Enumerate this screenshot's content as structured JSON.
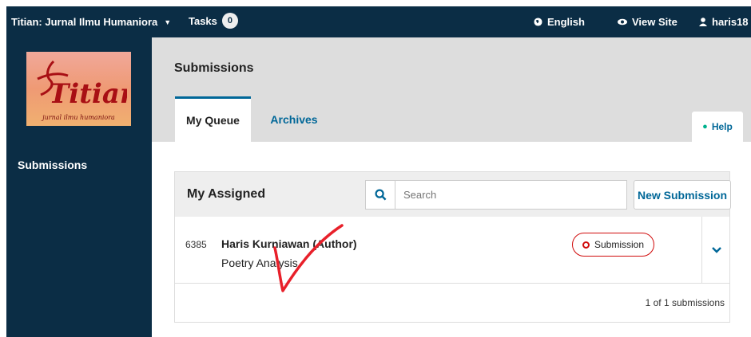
{
  "topbar": {
    "context": "Titian: Jurnal Ilmu Humaniora",
    "tasks_label": "Tasks",
    "tasks_count": "0",
    "language": "English",
    "view_site": "View Site",
    "user": "haris18"
  },
  "sidebar": {
    "logo": {
      "wordmark": "Titian",
      "tagline": "jurnal ilmu humaniora"
    },
    "items": [
      {
        "label": "Submissions"
      }
    ]
  },
  "header": {
    "title": "Submissions",
    "tabs": [
      {
        "label": "My Queue",
        "active": true
      },
      {
        "label": "Archives",
        "active": false
      }
    ],
    "help": "Help"
  },
  "panel": {
    "title": "My Assigned",
    "search": {
      "placeholder": "Search",
      "value": ""
    },
    "new_submission": "New Submission",
    "rows": [
      {
        "id": "6385",
        "author": "Haris Kurniawan (Author)",
        "title": "Poetry Analysis",
        "stage": "Submission"
      }
    ],
    "count_text": "1 of 1 submissions"
  },
  "colors": {
    "topbar_bg": "#0b2d45",
    "link": "#006798",
    "badge_border": "#d00a0a",
    "help_icon": "#00b28e",
    "annotation": "#e8202a"
  },
  "icons": {
    "context_caret": "caret-down-icon",
    "language": "globe-icon",
    "view_site": "eye-icon",
    "user": "user-icon",
    "help": "info-icon",
    "search": "search-icon",
    "expand": "chevron-down-icon"
  }
}
